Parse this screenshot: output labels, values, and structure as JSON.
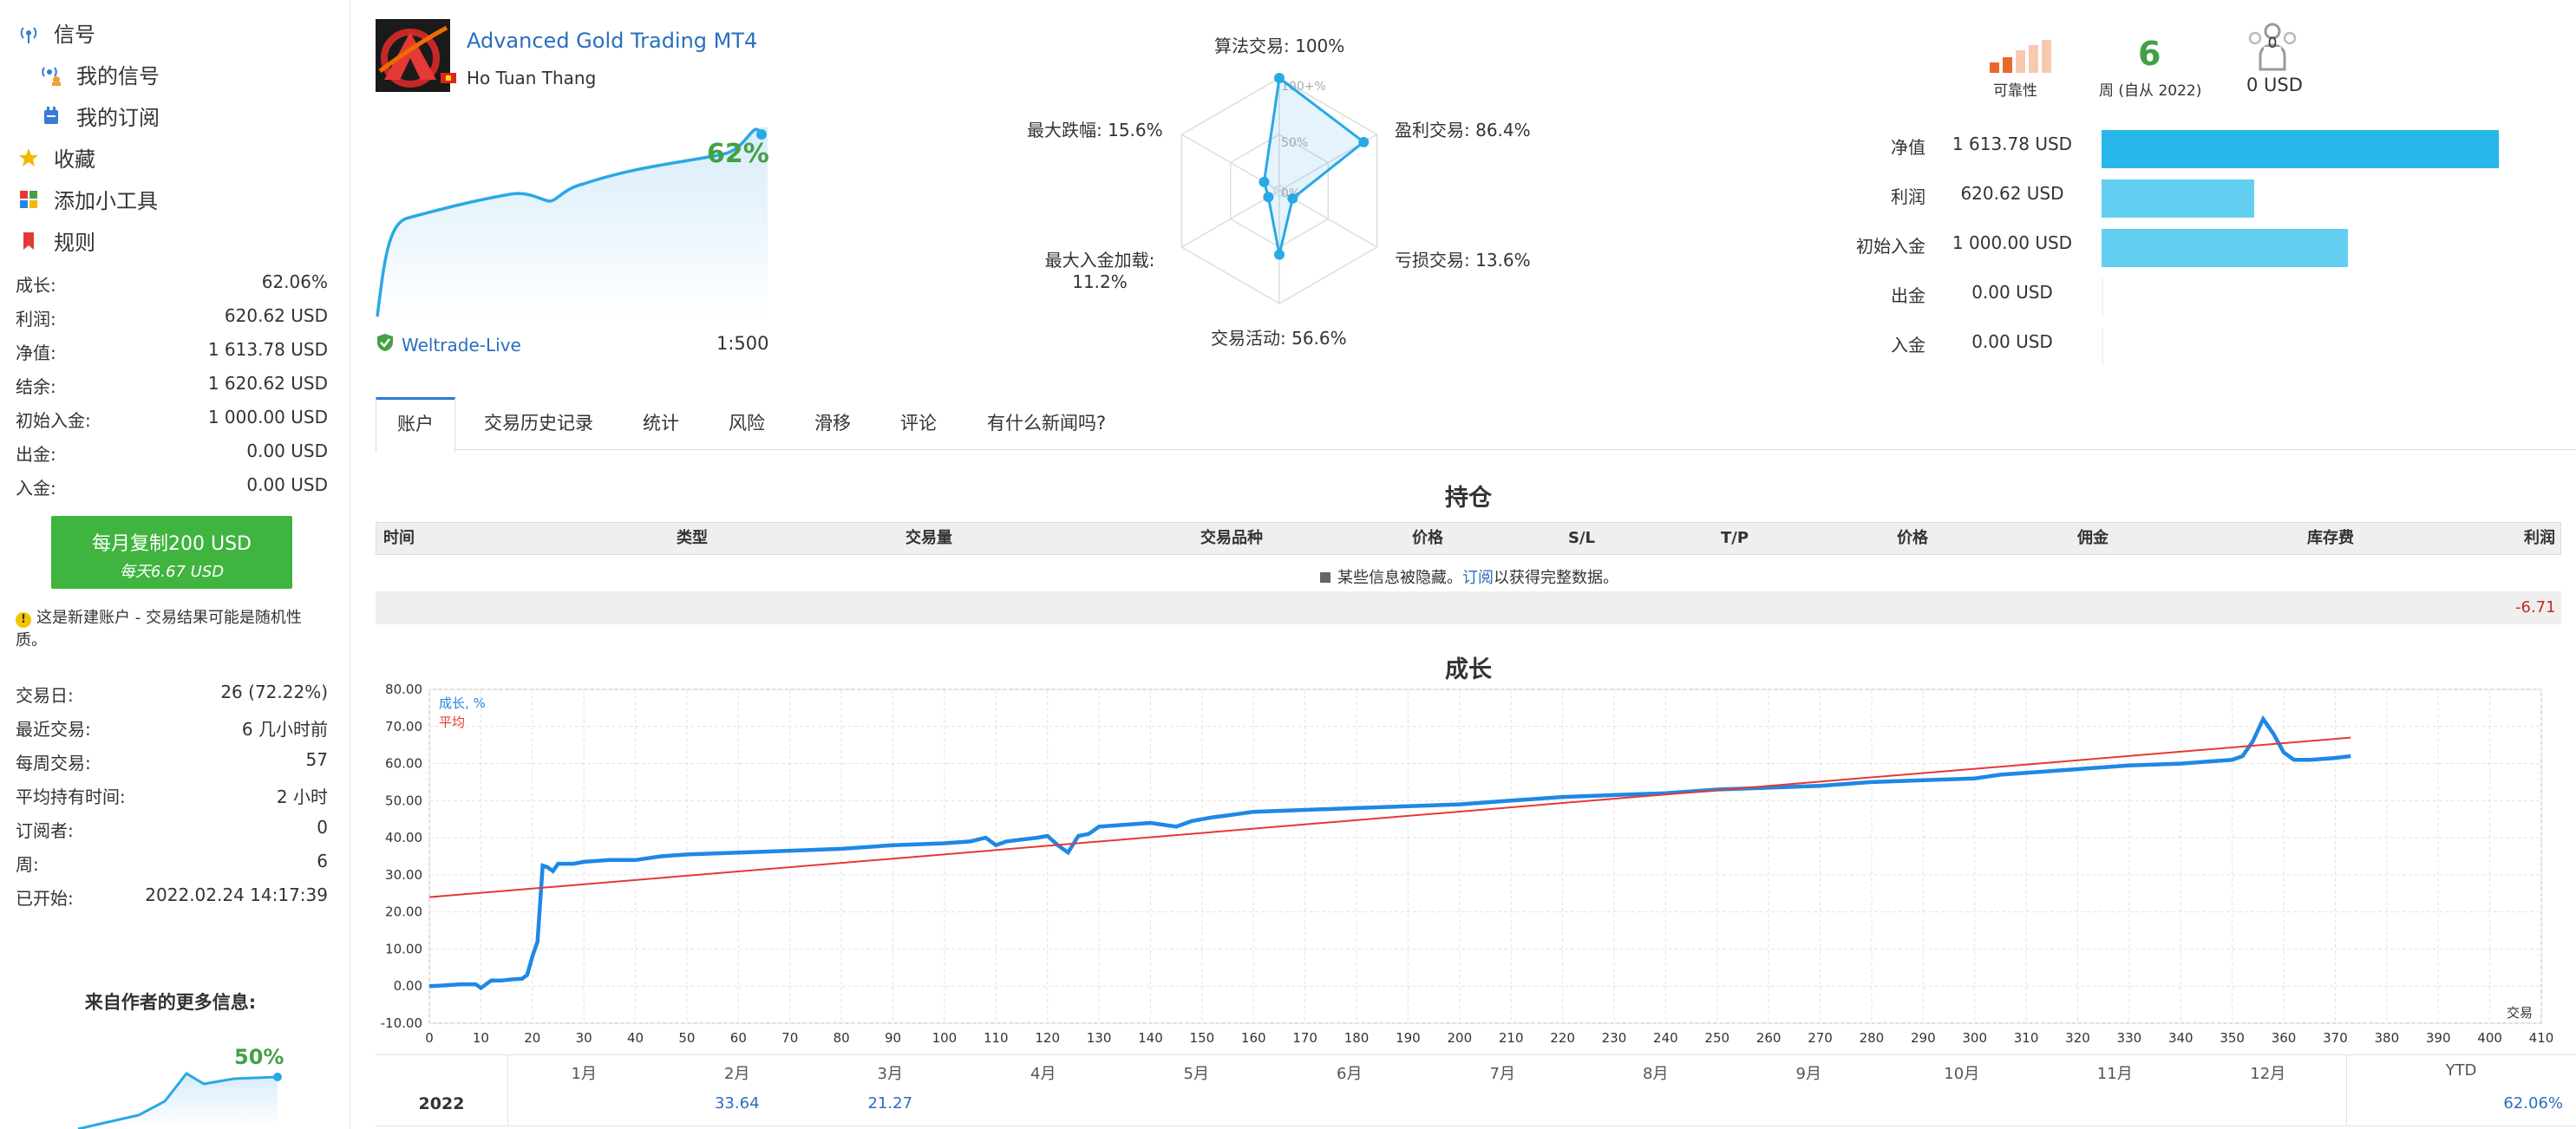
{
  "sidebar": {
    "nav": [
      {
        "label": "信号"
      },
      {
        "label": "我的信号"
      },
      {
        "label": "我的订阅"
      },
      {
        "label": "收藏"
      },
      {
        "label": "添加小工具"
      },
      {
        "label": "规则"
      }
    ],
    "stats": [
      {
        "label": "成长:",
        "value": "62.06%"
      },
      {
        "label": "利润:",
        "value": "620.62 USD"
      },
      {
        "label": "净值:",
        "value": "1 613.78 USD"
      },
      {
        "label": "结余:",
        "value": "1 620.62 USD"
      },
      {
        "label": "初始入金:",
        "value": "1 000.00 USD"
      },
      {
        "label": "出金:",
        "value": "0.00 USD"
      },
      {
        "label": "入金:",
        "value": "0.00 USD"
      }
    ],
    "copy_button": {
      "line1": "每月复制200 USD",
      "line2": "每天6.67 USD"
    },
    "warning": "这是新建账户 - 交易结果可能是随机性质。",
    "info": [
      {
        "label": "交易日:",
        "value": "26 (72.22%)"
      },
      {
        "label": "最近交易:",
        "value": "6 几小时前"
      },
      {
        "label": "每周交易:",
        "value": "57"
      },
      {
        "label": "平均持有时间:",
        "value": "2 小时"
      },
      {
        "label": "订阅者:",
        "value": "0"
      },
      {
        "label": "周:",
        "value": "6"
      },
      {
        "label": "已开始:",
        "value": "2022.02.24 14:17:39"
      }
    ],
    "author_title": "来自作者的更多信息:",
    "author_growth": "50%"
  },
  "header": {
    "signal_name": "Advanced Gold Trading MT4",
    "author": "Ho Tuan Thang",
    "growth": "62%",
    "broker": "Weltrade-Live",
    "leverage": "1:500"
  },
  "radar": {
    "center_labels": [
      "100+%",
      "50%",
      "0%"
    ],
    "axes": [
      {
        "label": "算法交易:",
        "value": "100%",
        "pct": 100
      },
      {
        "label": "盈利交易:",
        "value": "86.4%",
        "pct": 86.4
      },
      {
        "label": "亏损交易:",
        "value": "13.6%",
        "pct": 13.6
      },
      {
        "label": "交易活动:",
        "value": "56.6%",
        "pct": 56.6
      },
      {
        "label": "最大入金加载:",
        "value": "11.2%",
        "pct": 11.2
      },
      {
        "label": "最大跌幅:",
        "value": "15.6%",
        "pct": 15.6
      }
    ]
  },
  "top_right": {
    "reliability_label": "可靠性",
    "weeks_value": "6",
    "weeks_label": "周 (自从 2022)",
    "subscribers_badge": "0",
    "subscribers_value": "0 USD",
    "colors": {
      "bar_dark": "#29b6ea",
      "bar_light": "#62cff0",
      "reliability": "#e8692c"
    },
    "bars": [
      {
        "label": "净值",
        "value": "1 613.78 USD",
        "amount": 1613.78
      },
      {
        "label": "利润",
        "value": "620.62 USD",
        "amount": 620.62
      },
      {
        "label": "初始入金",
        "value": "1 000.00 USD",
        "amount": 1000.0
      },
      {
        "label": "出金",
        "value": "0.00 USD",
        "amount": 0
      },
      {
        "label": "入金",
        "value": "0.00 USD",
        "amount": 0
      }
    ]
  },
  "tabs": [
    "账户",
    "交易历史记录",
    "统计",
    "风险",
    "滑移",
    "评论",
    "有什么新闻吗?"
  ],
  "positions": {
    "title": "持仓",
    "columns": [
      "时间",
      "类型",
      "交易量",
      "交易品种",
      "价格",
      "S/L",
      "T/P",
      "价格",
      "佣金",
      "库存费",
      "利润"
    ],
    "hidden_note_prefix": "某些信息被隐藏。",
    "hidden_note_link": "订阅",
    "hidden_note_suffix": "以获得完整数据。",
    "total": "-6.71"
  },
  "growth_chart": {
    "title": "成长",
    "legend_growth": "成长, %",
    "legend_avg": "平均",
    "x_axis_label": "交易",
    "y_ticks": [
      "80.00",
      "70.00",
      "60.00",
      "50.00",
      "40.00",
      "30.00",
      "20.00",
      "10.00",
      "0.00",
      "-10.00"
    ],
    "x_ticks": [
      "0",
      "10",
      "20",
      "30",
      "40",
      "50",
      "60",
      "70",
      "80",
      "90",
      "100",
      "110",
      "120",
      "130",
      "140",
      "150",
      "160",
      "170",
      "180",
      "190",
      "200",
      "210",
      "220",
      "230",
      "240",
      "250",
      "260",
      "270",
      "280",
      "290",
      "300",
      "310",
      "320",
      "330",
      "340",
      "350",
      "360",
      "370",
      "380",
      "390",
      "400",
      "410"
    ],
    "months": [
      "1月",
      "2月",
      "3月",
      "4月",
      "5月",
      "6月",
      "7月",
      "8月",
      "9月",
      "10月",
      "11月",
      "12月",
      "YTD"
    ],
    "year_row": {
      "year": "2022",
      "feb": "33.64",
      "mar": "21.27",
      "ytd": "62.06%"
    }
  },
  "chart_data": {
    "type": "line",
    "title": "成长",
    "xlabel": "交易",
    "ylabel": "",
    "xlim": [
      0,
      410
    ],
    "ylim": [
      -10,
      80
    ],
    "series": [
      {
        "name": "成长, %",
        "color": "#1e88e5",
        "x": [
          0,
          3,
          6,
          9,
          10,
          12,
          14,
          16,
          18,
          19,
          20,
          21,
          22,
          23,
          24,
          25,
          28,
          30,
          35,
          40,
          45,
          50,
          60,
          70,
          80,
          90,
          100,
          105,
          108,
          110,
          112,
          115,
          118,
          120,
          122,
          124,
          126,
          128,
          130,
          135,
          140,
          145,
          148,
          150,
          152,
          155,
          160,
          170,
          180,
          190,
          200,
          210,
          220,
          230,
          240,
          250,
          260,
          270,
          280,
          290,
          300,
          305,
          310,
          320,
          330,
          340,
          345,
          350,
          352,
          354,
          356,
          358,
          360,
          362,
          365,
          370,
          373
        ],
        "y": [
          0,
          0.2,
          0.5,
          0.5,
          -0.5,
          1.5,
          1.5,
          1.8,
          2,
          3,
          8,
          12,
          32.5,
          32,
          31,
          33,
          33,
          33.5,
          34,
          34,
          35,
          35.5,
          36,
          36.5,
          37,
          38,
          38.5,
          39,
          40,
          38,
          39,
          39.5,
          40,
          40.5,
          38,
          36,
          40.5,
          41,
          43,
          43.5,
          44,
          43,
          44.5,
          45,
          45.5,
          46,
          47,
          47.5,
          48,
          48.5,
          49,
          50,
          51,
          51.5,
          52,
          53,
          53.5,
          54,
          55,
          55.5,
          56,
          57,
          57.5,
          58.5,
          59.5,
          60,
          60.5,
          61,
          62,
          66,
          72,
          68,
          63,
          61,
          61,
          61.5,
          62
        ]
      },
      {
        "name": "平均",
        "color": "#e53935",
        "x": [
          0,
          373
        ],
        "y": [
          24,
          67
        ]
      }
    ]
  },
  "mini_chart": {
    "type": "line",
    "x": [
      0,
      5,
      10,
      15,
      20,
      25,
      30,
      35,
      40,
      45,
      50,
      55,
      60,
      65,
      70,
      75,
      80,
      85,
      90,
      95,
      100
    ],
    "y": [
      0,
      22,
      38,
      42,
      44,
      46,
      48,
      50,
      51,
      50,
      53,
      55,
      56,
      57,
      58,
      59,
      60,
      61,
      62,
      64,
      63
    ]
  }
}
